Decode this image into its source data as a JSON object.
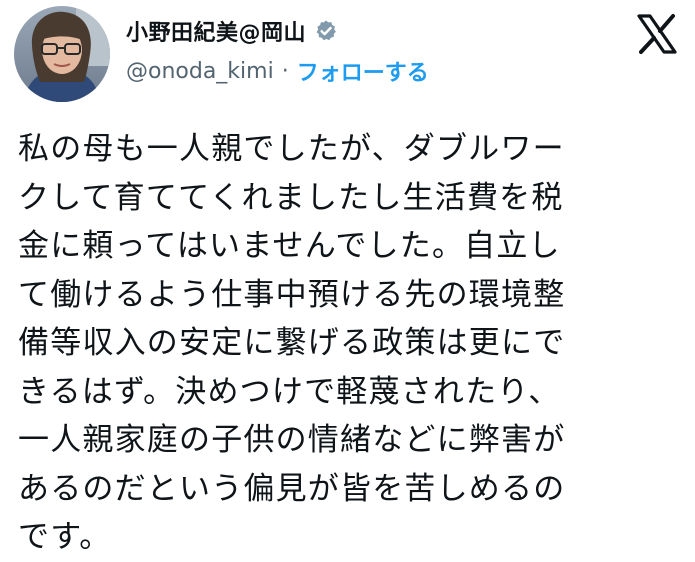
{
  "author": {
    "display_name": "小野田紀美@岡山",
    "handle": "@onoda_kimi",
    "separator": "·",
    "follow_label": "フォローする",
    "verified_icon": "verified-badge-icon",
    "avatar_icon": "profile-avatar"
  },
  "brand": {
    "logo_icon": "x-logo-icon",
    "accent_color": "#1d9bf0",
    "text_color": "#0f1419",
    "muted_color": "#536471"
  },
  "tweet": {
    "lines": [
      "私の母も一人親でしたが、ダブルワー",
      "クして育ててくれましたし生活費を税",
      "金に頼ってはいませんでした。自立し",
      "て働けるよう仕事中預ける先の環境整",
      "備等収入の安定に繋げる政策は更にで",
      "きるはず。決めつけで軽蔑されたり、",
      "一人親家庭の子供の情緒などに弊害が",
      "あるのだという偏見が皆を苦しめるの",
      "です。"
    ]
  }
}
